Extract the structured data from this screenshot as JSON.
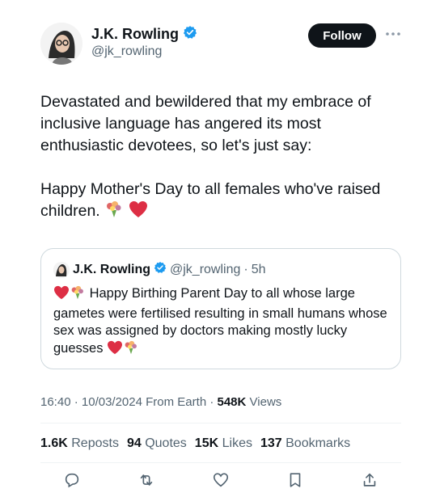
{
  "author": {
    "name": "J.K. Rowling",
    "handle": "@jk_rowling",
    "follow_label": "Follow"
  },
  "tweet": {
    "paragraph_1": "Devastated and bewildered that my embrace of inclusive language has angered its most enthusiastic devotees, so let's just say:",
    "paragraph_2": "Happy Mother's Day to all females who've raised children."
  },
  "quote": {
    "name": "J.K. Rowling",
    "handle": "@jk_rowling",
    "time": "5h",
    "text": "Happy Birthing Parent Day to all whose large gametes were fertilised resulting in small humans whose sex was assigned by doctors making mostly lucky guesses"
  },
  "meta": {
    "time": "16:40",
    "date": "10/03/2024",
    "source": "From Earth",
    "views_count": "548K",
    "views_label": "Views"
  },
  "stats": {
    "reposts_count": "1.6K",
    "reposts_label": "Reposts",
    "quotes_count": "94",
    "quotes_label": "Quotes",
    "likes_count": "15K",
    "likes_label": "Likes",
    "bookmarks_count": "137",
    "bookmarks_label": "Bookmarks"
  },
  "icons": {
    "verified": "verified-badge-icon",
    "heart_emoji": "red-heart-icon",
    "bouquet_emoji": "bouquet-icon",
    "more": "more-icon",
    "reply": "reply-icon",
    "repost": "repost-icon",
    "like": "like-icon",
    "bookmark": "bookmark-icon",
    "share": "share-icon"
  },
  "colors": {
    "verified_blue": "#1d9bf0",
    "text_primary": "#0f1419",
    "text_secondary": "#536471",
    "heart_red": "#e0245e"
  }
}
